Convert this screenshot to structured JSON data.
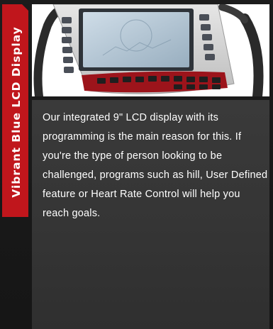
{
  "feature": {
    "side_title": "Vibrant Blue LCD Display",
    "image_icon": "lcd-console-photo",
    "description": "Our integrated 9\" LCD display with its programming is the main reason for this.  If you're the type of person looking to be challenged, programs such as hill, User Defined feature or Heart Rate Control will help you reach goals."
  },
  "colors": {
    "accent": "#c0161c",
    "background": "#1b1b1b",
    "panel": "#373737",
    "text": "#ffffff"
  }
}
